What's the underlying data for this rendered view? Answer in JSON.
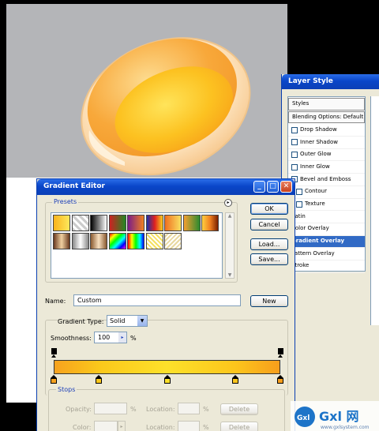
{
  "layer_style": {
    "title": "Layer Style",
    "items": [
      {
        "label": "Styles",
        "checkbox": false,
        "boxed": true,
        "selected": false
      },
      {
        "label": "Blending Options: Default",
        "checkbox": false,
        "boxed": true,
        "selected": false
      },
      {
        "label": "Drop Shadow",
        "checkbox": true,
        "boxed": false,
        "selected": false
      },
      {
        "label": "Inner Shadow",
        "checkbox": true,
        "boxed": false,
        "selected": false
      },
      {
        "label": "Outer Glow",
        "checkbox": true,
        "boxed": false,
        "selected": false
      },
      {
        "label": "Inner Glow",
        "checkbox": true,
        "boxed": false,
        "selected": false
      },
      {
        "label": "Bevel and Emboss",
        "checkbox": true,
        "boxed": false,
        "selected": false
      },
      {
        "label": "Contour",
        "checkbox": true,
        "boxed": false,
        "selected": false
      },
      {
        "label": "Texture",
        "checkbox": true,
        "boxed": false,
        "selected": false
      },
      {
        "label": "Satin",
        "checkbox": true,
        "boxed": false,
        "selected": false
      },
      {
        "label": "Color Overlay",
        "checkbox": true,
        "boxed": false,
        "selected": false
      },
      {
        "label": "Gradient Overlay",
        "checkbox": true,
        "boxed": false,
        "selected": true
      },
      {
        "label": "Pattern Overlay",
        "checkbox": true,
        "boxed": false,
        "selected": false
      },
      {
        "label": "Stroke",
        "checkbox": true,
        "boxed": false,
        "selected": false
      }
    ]
  },
  "gradient_editor": {
    "title": "Gradient Editor",
    "presets_label": "Presets",
    "buttons": {
      "ok": "OK",
      "cancel": "Cancel",
      "load": "Load...",
      "save": "Save...",
      "new": "New"
    },
    "name_label": "Name:",
    "name_value": "Custom",
    "gradient_type_label": "Gradient Type:",
    "gradient_type_value": "Solid",
    "smoothness_label": "Smoothness:",
    "smoothness_value": "100",
    "percent": "%",
    "stops_label": "Stops",
    "opacity_label": "Opacity:",
    "location_label": "Location:",
    "color_label": "Color:",
    "delete_label": "Delete",
    "gradient_colors": [
      "#f7a21e",
      "#fbc81b",
      "#fde12a",
      "#fcc61c",
      "#f79e1c"
    ],
    "color_stop_positions": [
      0,
      0.2,
      0.5,
      0.8,
      1.0
    ],
    "opacity_stop_positions": [
      0,
      1.0
    ]
  },
  "watermark": {
    "text": "Gxl 网",
    "url": "www.gxlsystem.com"
  },
  "colors": {
    "accent": "#316ac5",
    "titlebar": "#0a46c9",
    "panel": "#ece9d8"
  }
}
